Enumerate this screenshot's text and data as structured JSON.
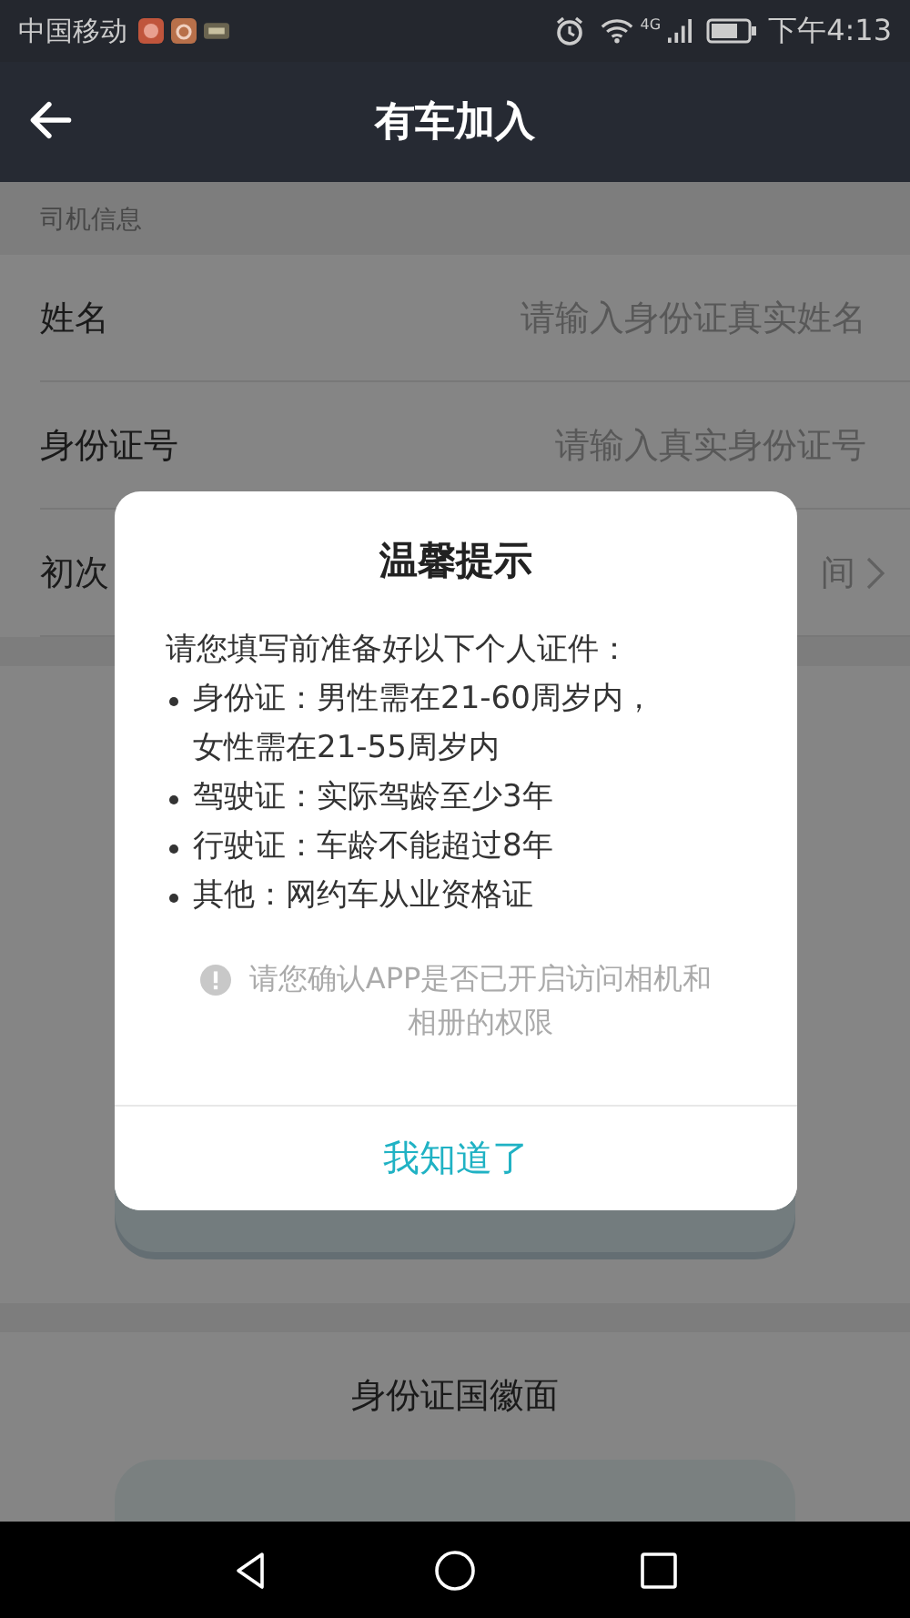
{
  "status_bar": {
    "carrier": "中国移动",
    "network": "4G",
    "time": "下午4:13"
  },
  "header": {
    "title": "有车加入"
  },
  "section_label": "司机信息",
  "form_rows": [
    {
      "kind": "input",
      "label": "姓名",
      "placeholder": "请输入身份证真实姓名"
    },
    {
      "kind": "input",
      "label": "身份证号",
      "placeholder": "请输入真实身份证号"
    },
    {
      "kind": "select",
      "label": "初次",
      "value": "间"
    }
  ],
  "upload": {
    "label": "身份证国徽面"
  },
  "dialog": {
    "title": "温馨提示",
    "intro": "请您填写前准备好以下个人证件：",
    "items": [
      {
        "lines": [
          "身份证：男性需在21-60周岁内，",
          "女性需在21-55周岁内"
        ]
      },
      {
        "lines": [
          "驾驶证：实际驾龄至少3年"
        ]
      },
      {
        "lines": [
          "行驶证：车龄不能超过8年"
        ]
      },
      {
        "lines": [
          "其他：网约车从业资格证"
        ]
      }
    ],
    "note": "请您确认APP是否已开启访问相机和相册的权限",
    "button": "我知道了"
  }
}
